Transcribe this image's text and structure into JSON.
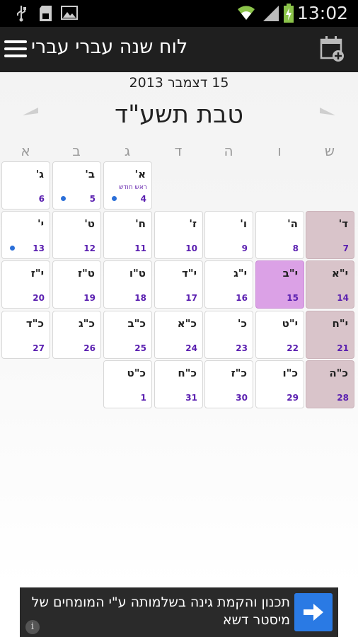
{
  "status_bar": {
    "time": "13:02",
    "icons": [
      "usb-icon",
      "sd-card-icon",
      "image-icon",
      "wifi-icon",
      "signal-icon",
      "battery-icon"
    ]
  },
  "action_bar": {
    "title": "לוח שנה עברי עברי",
    "menu_icon": "hamburger-icon",
    "add_icon": "calendar-add-icon"
  },
  "header": {
    "gregorian_date": "15 דצמבר 2013",
    "hebrew_month": "טבת תשע\"ד"
  },
  "weekdays": [
    "ש",
    "ו",
    "ה",
    "ד",
    "ג",
    "ב",
    "א"
  ],
  "days": [
    {
      "heb": "א'",
      "greg": "4",
      "note": "ראש חודש",
      "dot": true
    },
    {
      "heb": "ב'",
      "greg": "5",
      "dot": true
    },
    {
      "heb": "ג'",
      "greg": "6"
    },
    {
      "heb": "ד'",
      "greg": "7"
    },
    {
      "heb": "ה'",
      "greg": "8"
    },
    {
      "heb": "ו'",
      "greg": "9"
    },
    {
      "heb": "ז'",
      "greg": "10"
    },
    {
      "heb": "ח'",
      "greg": "11"
    },
    {
      "heb": "ט'",
      "greg": "12"
    },
    {
      "heb": "י'",
      "greg": "13",
      "dot": true
    },
    {
      "heb": "י\"א",
      "greg": "14"
    },
    {
      "heb": "י\"ב",
      "greg": "15",
      "today": true
    },
    {
      "heb": "י\"ג",
      "greg": "16"
    },
    {
      "heb": "י\"ד",
      "greg": "17"
    },
    {
      "heb": "ט\"ו",
      "greg": "18"
    },
    {
      "heb": "ט\"ז",
      "greg": "19"
    },
    {
      "heb": "י\"ז",
      "greg": "20"
    },
    {
      "heb": "י\"ח",
      "greg": "21"
    },
    {
      "heb": "י\"ט",
      "greg": "22"
    },
    {
      "heb": "כ'",
      "greg": "23"
    },
    {
      "heb": "כ\"א",
      "greg": "24"
    },
    {
      "heb": "כ\"ב",
      "greg": "25"
    },
    {
      "heb": "כ\"ג",
      "greg": "26"
    },
    {
      "heb": "כ\"ד",
      "greg": "27"
    },
    {
      "heb": "כ\"ה",
      "greg": "28"
    },
    {
      "heb": "כ\"ו",
      "greg": "29"
    },
    {
      "heb": "כ\"ז",
      "greg": "30"
    },
    {
      "heb": "כ\"ח",
      "greg": "31"
    },
    {
      "heb": "כ\"ט",
      "greg": "1"
    }
  ],
  "ad": {
    "text": "תכנון והקמת גינה בשלמותה ע\"י המומחים של מיסטר דשא",
    "info": "i"
  },
  "colors": {
    "shabbat": "#d9c4ca",
    "today": "#dba1e6",
    "gregorian_number": "#5a1fb0",
    "event_dot": "#2b6fd8",
    "ad_button": "#2a7ae4"
  }
}
